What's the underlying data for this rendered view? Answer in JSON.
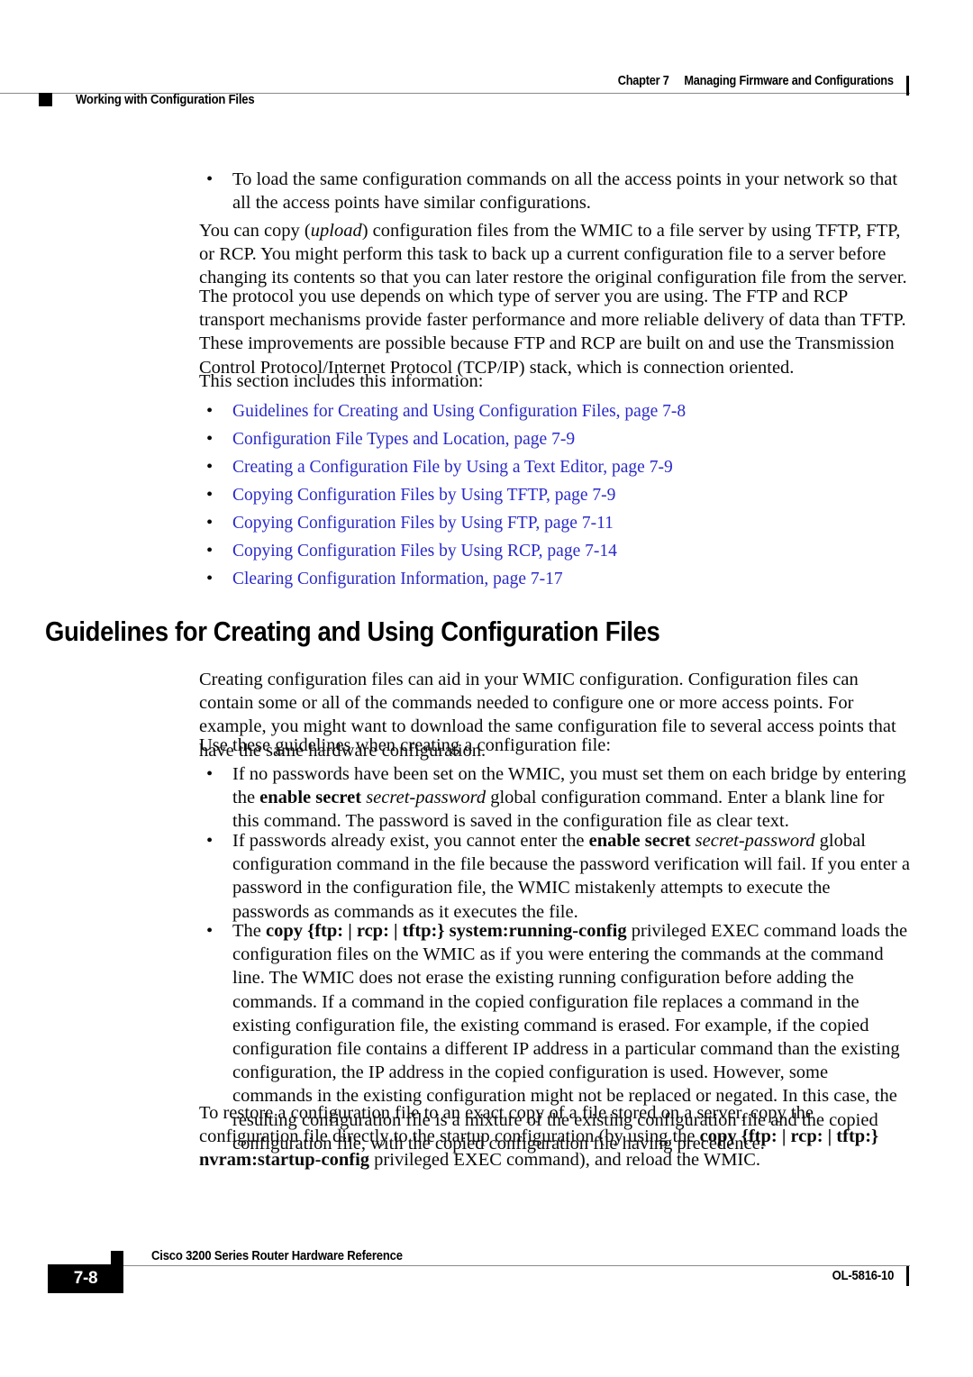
{
  "header": {
    "chapter_number": "Chapter 7",
    "chapter_title": "Managing Firmware and Configurations",
    "section_title": "Working with Configuration Files"
  },
  "body": {
    "intro_bullet": "To load the same configuration commands on all the access points in your network so that all the access points have similar configurations.",
    "para_upload_pre": "You can copy (",
    "para_upload_italic": "upload",
    "para_upload_post": ") configuration files from the WMIC to a file server by using TFTP, FTP, or RCP. You might perform this task to back up a current configuration file to a server before changing its contents so that you can later restore the original configuration file from the server.",
    "para_protocol": "The protocol you use depends on which type of server you are using. The FTP and RCP transport mechanisms provide faster performance and more reliable delivery of data than TFTP. These improvements are possible because FTP and RCP are built on and use the Transmission Control Protocol/Internet Protocol (TCP/IP) stack, which is connection oriented.",
    "para_section_includes": "This section includes this information:",
    "links": [
      "Guidelines for Creating and Using Configuration Files, page 7-8",
      "Configuration File Types and Location, page 7-9",
      "Creating a Configuration File by Using a Text Editor, page 7-9",
      "Copying Configuration Files by Using TFTP, page 7-9",
      "Copying Configuration Files by Using FTP, page 7-11",
      "Copying Configuration Files by Using RCP, page 7-14",
      "Clearing Configuration Information, page 7-17"
    ],
    "section_heading": "Guidelines for Creating and Using Configuration Files",
    "para_creating": "Creating configuration files can aid in your WMIC configuration. Configuration files can contain some or all of the commands needed to configure one or more access points. For example, you might want to download the same configuration file to several access points that have the same hardware configuration.",
    "para_use_guidelines": "Use these guidelines when creating a configuration file:",
    "guideline_1": {
      "part1": "If no passwords have been set on the WMIC, you must set them on each bridge by entering the ",
      "bold1": "enable secret",
      "space1": " ",
      "italic1": "secret-password",
      "part2": " global configuration command. Enter a blank line for this command. The password is saved in the configuration file as clear text."
    },
    "guideline_2": {
      "part1": "If passwords already exist, you cannot enter the ",
      "bold1": "enable secret",
      "space1": " ",
      "italic1": "secret-password",
      "part2": " global configuration command in the file because the password verification will fail. If you enter a password in the configuration file, the WMIC mistakenly attempts to execute the passwords as commands as it executes the file."
    },
    "guideline_3": {
      "part1": "The ",
      "bold1": "copy",
      "bold2": " {ftp: | rcp: | tftp:}",
      "bold3": " system:running-config",
      "part2": " privileged EXEC command loads the configuration files on the WMIC as if you were entering the commands at the command line. The WMIC does not erase the existing running configuration before adding the commands. If a command in the copied configuration file replaces a command in the existing configuration file, the existing command is erased. For example, if the copied configuration file contains a different IP address in a particular command than the existing configuration, the IP address in the copied configuration is used. However, some commands in the existing configuration might not be replaced or negated. In this case, the resulting configuration file is a mixture of the existing configuration file and the copied configuration file, with the copied configuration file having precedence."
    },
    "para_restore": {
      "part1": "To restore a configuration file to an exact copy of a file stored on a server, copy the configuration file directly to the startup configuration (by using the ",
      "bold1": "copy",
      "bold2": " {ftp: | rcp: | tftp:}",
      "bold3": "nvram:startup-config",
      "part2": " privileged EXEC command), and reload the WMIC."
    },
    "bullet_glyph": "•"
  },
  "footer": {
    "doc_title": "Cisco 3200 Series Router Hardware Reference",
    "page_number": "7-8",
    "doc_number": "OL-5816-10"
  },
  "colors": {
    "link_blue": "#2a2ac8",
    "rule_gray": "#8a8a8a",
    "ink_black": "#000000"
  }
}
